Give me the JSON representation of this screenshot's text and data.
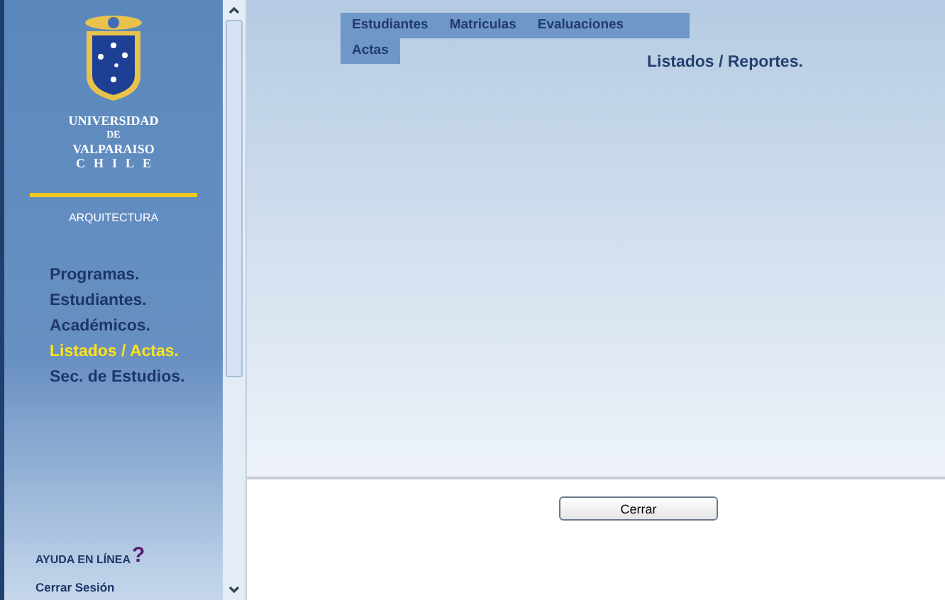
{
  "logo": {
    "lines": [
      "UNIVERSIDAD",
      "DE",
      "VALPARAISO",
      "CHILE"
    ]
  },
  "faculty": "ARQUITECTURA",
  "sidebar": {
    "items": [
      {
        "label": "Programas.",
        "selected": false
      },
      {
        "label": "Estudiantes.",
        "selected": false
      },
      {
        "label": "Académicos.",
        "selected": false
      },
      {
        "label": "Listados / Actas.",
        "selected": true
      },
      {
        "label": "Sec. de Estudios.",
        "selected": false
      }
    ]
  },
  "help": {
    "label": "AYUDA EN LÍNEA",
    "icon": "?"
  },
  "logout": "Cerrar Sesión",
  "top_menu": {
    "rows": [
      [
        "Estudiantes",
        "Matriculas",
        "Evaluaciones"
      ],
      [
        "Actas"
      ]
    ]
  },
  "page_title": "Listados / Reportes.",
  "close_button": "Cerrar"
}
